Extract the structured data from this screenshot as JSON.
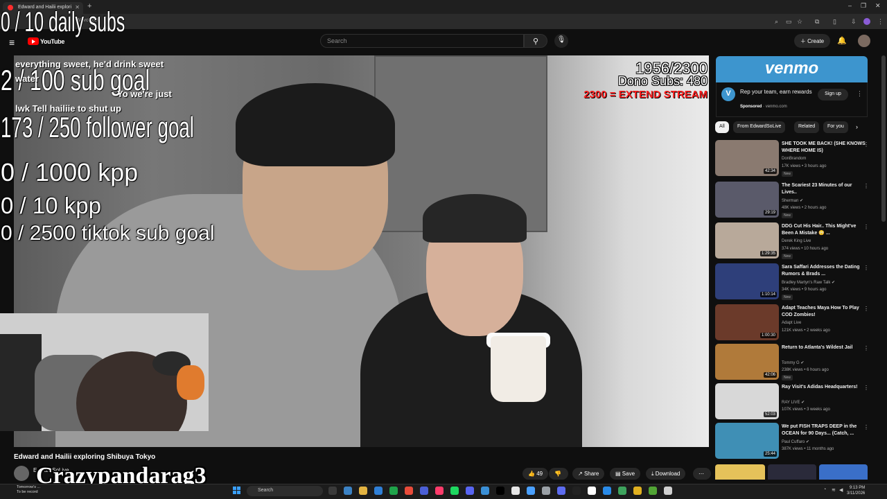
{
  "browser": {
    "tab_title": "Edward and Hailii explori",
    "url": "W2voVc6U",
    "new_tab": "+",
    "controls": [
      "–",
      "❐",
      "✕"
    ]
  },
  "youtube": {
    "logo_text": "YouTube",
    "search_placeholder": "Search",
    "create_label": "Create"
  },
  "overlay": {
    "daily_subs": "0 / 10 daily subs",
    "sub_goal": "2 / 100 sub goal",
    "follower_goal": "173 / 250 follower goal",
    "kpp_1000": "0 / 1000 kpp",
    "kpp_10": "0 / 10 kpp",
    "tiktok_goal": "0 / 2500 tiktok sub goal",
    "chat": [
      "everything sweet, he'd drink sweet",
      "water",
      "Yo we're just",
      "lwk Tell hailiie to shut up"
    ],
    "donation_progress": "1956/2300",
    "dono_subs": "Dono Subs: 480",
    "extend_stream": "2300 = EXTEND STREAM",
    "username": "Crazypandarag3"
  },
  "video": {
    "title": "Edward and Hailii exploring Shibuya Tokyo",
    "channel": "EdwardSoLive",
    "likes": "49",
    "share_label": "Share",
    "save_label": "Save",
    "download_label": "Download"
  },
  "ad": {
    "brand": "venmo",
    "logo_letter": "V",
    "text": "Rep your team, earn rewards",
    "sponsored": "Sponsored",
    "domain": "venmo.com",
    "button": "Sign up"
  },
  "chips": [
    "All",
    "From EdwardSoLive",
    "Related",
    "For you"
  ],
  "recommendations": [
    {
      "title": "SHE TOOK ME BACK! (SHE KNOWS WHERE HOME IS)",
      "channel": "DonBrandom",
      "meta": "17K views • 3 hours ago",
      "badge": "New",
      "duration": "42:34",
      "color": "#8a7a70"
    },
    {
      "title": "The Scariest 23 Minutes of our Lives..",
      "channel": "Sherman ✔",
      "meta": "48K views • 2 hours ago",
      "badge": "New",
      "duration": "29:19",
      "color": "#5a5a6a"
    },
    {
      "title": "DDG Cut His Hair.. This Might've Been A Mistake 😳 ...",
      "channel": "Derek King Live",
      "meta": "374 views • 10 hours ago",
      "badge": "New",
      "duration": "1:29:35",
      "color": "#b8a99a"
    },
    {
      "title": "Sara Saffari Addresses the Dating Rumors & Brads ...",
      "channel": "Bradley Martyn's Raw Talk ✔",
      "meta": "34K views • 9 hours ago",
      "badge": "New",
      "duration": "1:10:14",
      "color": "#2e3f7a"
    },
    {
      "title": "Adapt Teaches Maya How To Play COD Zombies!",
      "channel": "Adapt Live",
      "meta": "121K views • 2 weeks ago",
      "badge": "",
      "duration": "1:00:30",
      "color": "#6b3a2a"
    },
    {
      "title": "Return to Atlanta's Wildest Jail",
      "channel": "Tommy G ✔",
      "meta": "238K views • 6 hours ago",
      "badge": "New",
      "duration": "42:06",
      "color": "#b07a3a"
    },
    {
      "title": "Ray Visit's Adidas Headquarters!",
      "channel": "RAY LIVE ✔",
      "meta": "107K views • 3 weeks ago",
      "badge": "",
      "duration": "52:03",
      "color": "#d8d8d8"
    },
    {
      "title": "We put FISH TRAPS DEEP in the OCEAN for 90 Days... (Catch, ...",
      "channel": "Paul Cuffaro ✔",
      "meta": "387K views • 11 months ago",
      "badge": "",
      "duration": "25:44",
      "color": "#3f8fb5"
    }
  ],
  "taskbar": {
    "notification_line1": "Tomorrow's ...",
    "notification_line2": "To be record",
    "search_placeholder": "Search",
    "time": "9:13 PM",
    "date": "3/11/2026"
  }
}
